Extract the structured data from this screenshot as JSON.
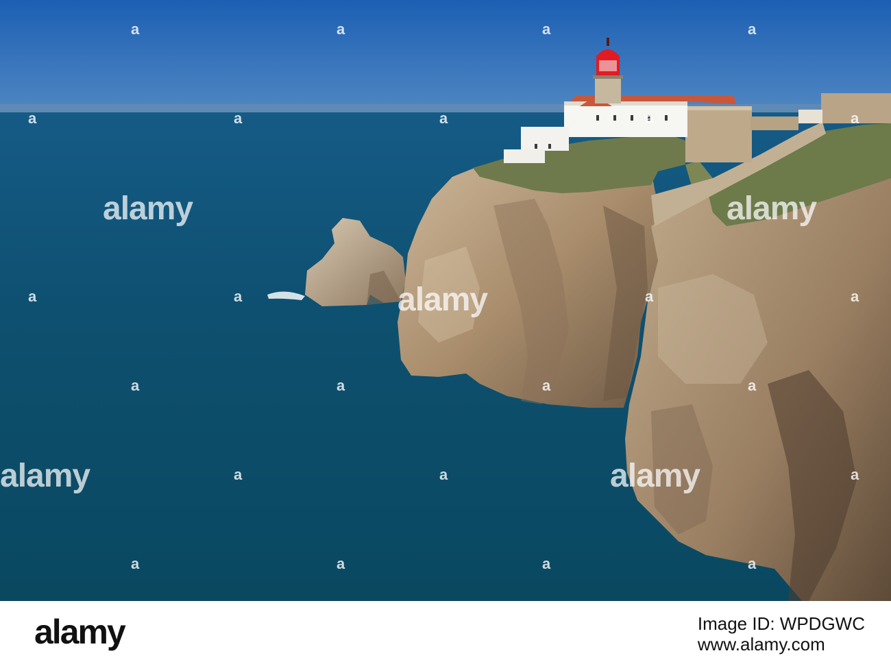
{
  "photo": {
    "description_colors": {
      "sky": "#1f66b8",
      "horizon": "#5d86b1",
      "sea": "#0d4f6b",
      "cliff": "#b39a7c",
      "lighthouse_lantern": "#e01b24",
      "roof": "#c9573a",
      "walls": "#ffffff"
    }
  },
  "watermark": {
    "logo_text": "alamy",
    "a_glyph": "a"
  },
  "footer": {
    "logo": "alamy",
    "image_id": "Image ID: WPDGWC",
    "url": "www.alamy.com"
  }
}
